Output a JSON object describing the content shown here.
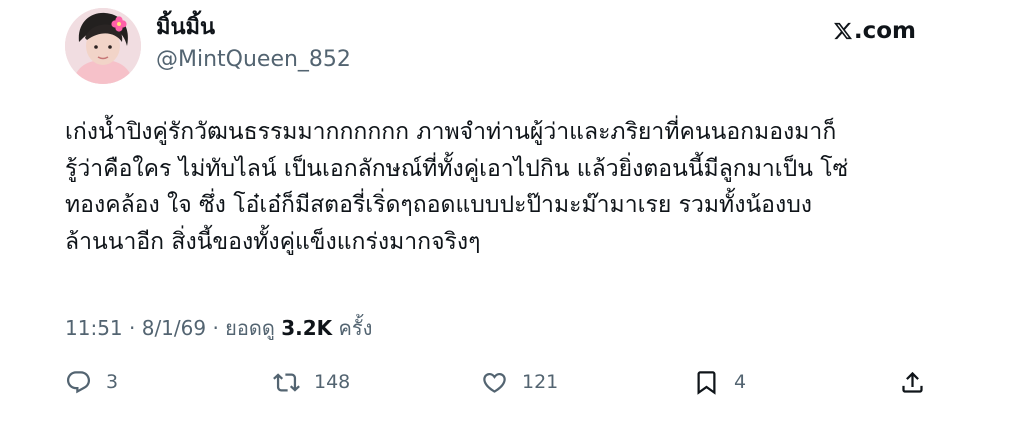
{
  "author": {
    "display_name": "มิ้นมิ้น",
    "handle": "@MintQueen_852"
  },
  "brand": {
    "text": ".com",
    "icon": "x-logo-icon"
  },
  "tweet": {
    "lines": [
      "เก่งน้ำปิงคู่รักวัฒนธรรมมากกกกกก ภาพจำท่านผู้ว่าและภริยาที่คนนอกมองมาก็",
      "รู้ว่าคือใคร ไม่ทับไลน์ เป็นเอกลักษณ์ที่ทั้งคู่เอาไปกิน แล้วยิ่งตอนนี้มีลูกมาเป็น โซ่",
      "ทองคล้อง ใจ ซึ่ง โอ๋เอ๋ก็มีสตอรี่เริ่ดๆถอดแบบปะป๊ามะม๊ามาเรย รวมทั้งน้องบง",
      "ล้านนาอีก สิ่งนี้ของทั้งคู่แข็งแกร่งมากจริงๆ"
    ]
  },
  "meta": {
    "time": "11:51",
    "sep1": " · ",
    "date": "8/1/69",
    "sep2": " · ",
    "views_label": "ยอดดู ",
    "views_count": "3.2K",
    "views_unit": " ครั้ง"
  },
  "actions": {
    "reply": {
      "icon": "reply-icon",
      "count": "3"
    },
    "retweet": {
      "icon": "retweet-icon",
      "count": "148"
    },
    "like": {
      "icon": "heart-icon",
      "count": "121"
    },
    "bookmark": {
      "icon": "bookmark-icon",
      "count": "4"
    },
    "share": {
      "icon": "share-icon"
    }
  },
  "colors": {
    "text_primary": "#0f1419",
    "text_secondary": "#536471",
    "background": "#ffffff"
  }
}
